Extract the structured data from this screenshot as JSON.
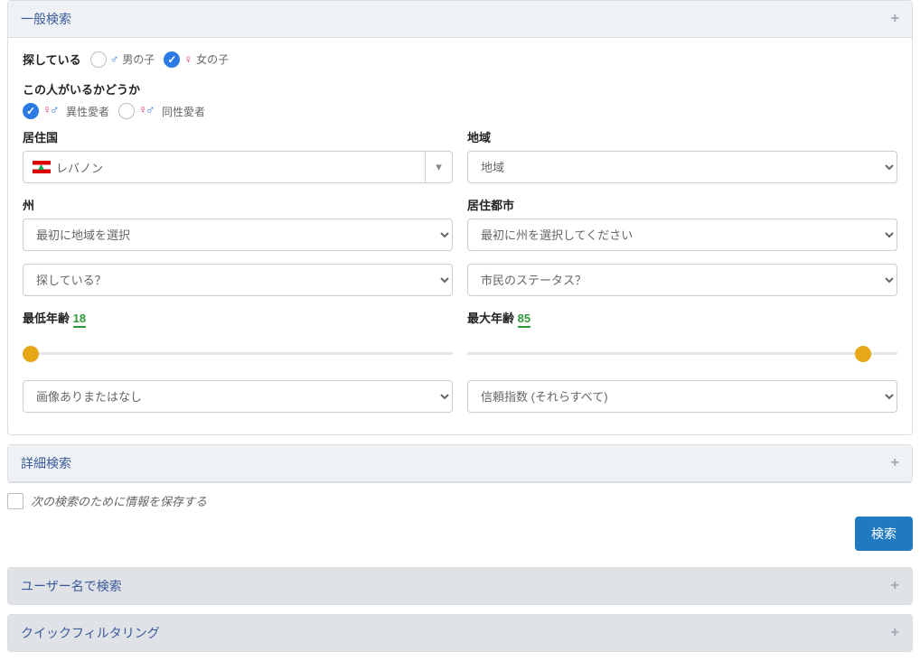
{
  "panels": {
    "general": {
      "title": "一般検索"
    },
    "advanced": {
      "title": "詳細検索"
    },
    "byUsername": {
      "title": "ユーザー名で検索"
    },
    "quickFilter": {
      "title": "クイックフィルタリング"
    }
  },
  "lookingFor": {
    "label": "探している",
    "boy": "男の子",
    "girl": "女の子"
  },
  "orientation": {
    "label": "この人がいるかどうか",
    "hetero": "異性愛者",
    "homo": "同性愛者"
  },
  "country": {
    "label": "居住国",
    "value": "レバノン"
  },
  "region": {
    "label": "地域",
    "placeholder": "地域"
  },
  "state": {
    "label": "州",
    "placeholder": "最初に地域を選択"
  },
  "city": {
    "label": "居住都市",
    "placeholder": "最初に州を選択してください"
  },
  "seeking": {
    "placeholder": "探している？"
  },
  "civilStatus": {
    "placeholder": "市民のステータス？"
  },
  "ageMin": {
    "label": "最低年齢",
    "value": "18"
  },
  "ageMax": {
    "label": "最大年齢",
    "value": "85"
  },
  "photoFilter": {
    "placeholder": "画像ありまたはなし"
  },
  "trustIndex": {
    "placeholder": "信頼指数 (それらすべて)"
  },
  "saveForNext": "次の検索のために情報を保存する",
  "searchBtn": "検索"
}
